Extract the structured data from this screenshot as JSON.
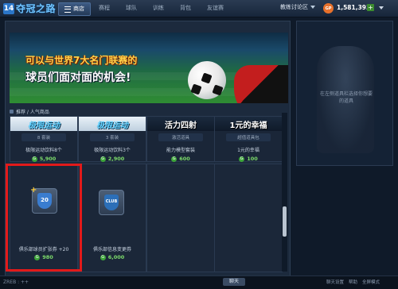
{
  "app": {
    "logo_mark": "14",
    "logo_text": "夺冠之路"
  },
  "nav": {
    "items": [
      {
        "label": "商店"
      },
      {
        "label": "赛程"
      },
      {
        "label": "球队"
      },
      {
        "label": "训练"
      },
      {
        "label": "背包"
      },
      {
        "label": "友谊赛"
      }
    ]
  },
  "header": {
    "forum": "教练讨论区",
    "gp_badge": "GP",
    "gp_value": "1,581,393",
    "gp_plus": "+"
  },
  "banner": {
    "line1": "可以与世界7大名门联赛的",
    "line2": "球员们面对面的机会!"
  },
  "side": {
    "text": "在左侧道具栏选择你想要的道具"
  },
  "section": {
    "title": "推荐 / 人气商品"
  },
  "cards": [
    {
      "banner": "极限运动",
      "sub": "8 套装",
      "name": "极限运动饮料8个",
      "price": "5,900"
    },
    {
      "banner": "极限运动",
      "sub": "3 套装",
      "name": "极限运动饮料3个",
      "price": "2,900"
    },
    {
      "banner": "活力四射",
      "sub": "激活道具",
      "name": "能力模型套装",
      "price": "600"
    },
    {
      "banner": "1元的幸福",
      "sub": "超值道具包",
      "name": "1元的幸福",
      "price": "100"
    }
  ],
  "row2": [
    {
      "icon_text": "20",
      "name": "俱乐部球员扩张券 +20",
      "price": "980"
    },
    {
      "icon_text": "CLUB",
      "name": "俱乐部信息变更券",
      "price": "6,000"
    }
  ],
  "chat": {
    "input": "ZREB : ++",
    "send": "聊天",
    "tools": [
      "聊天设置",
      "帮助",
      "全屏模式"
    ]
  },
  "colors": {
    "highlight": "#e21a1a",
    "accent": "#5fd1ff",
    "coin": "#3ea53a"
  }
}
